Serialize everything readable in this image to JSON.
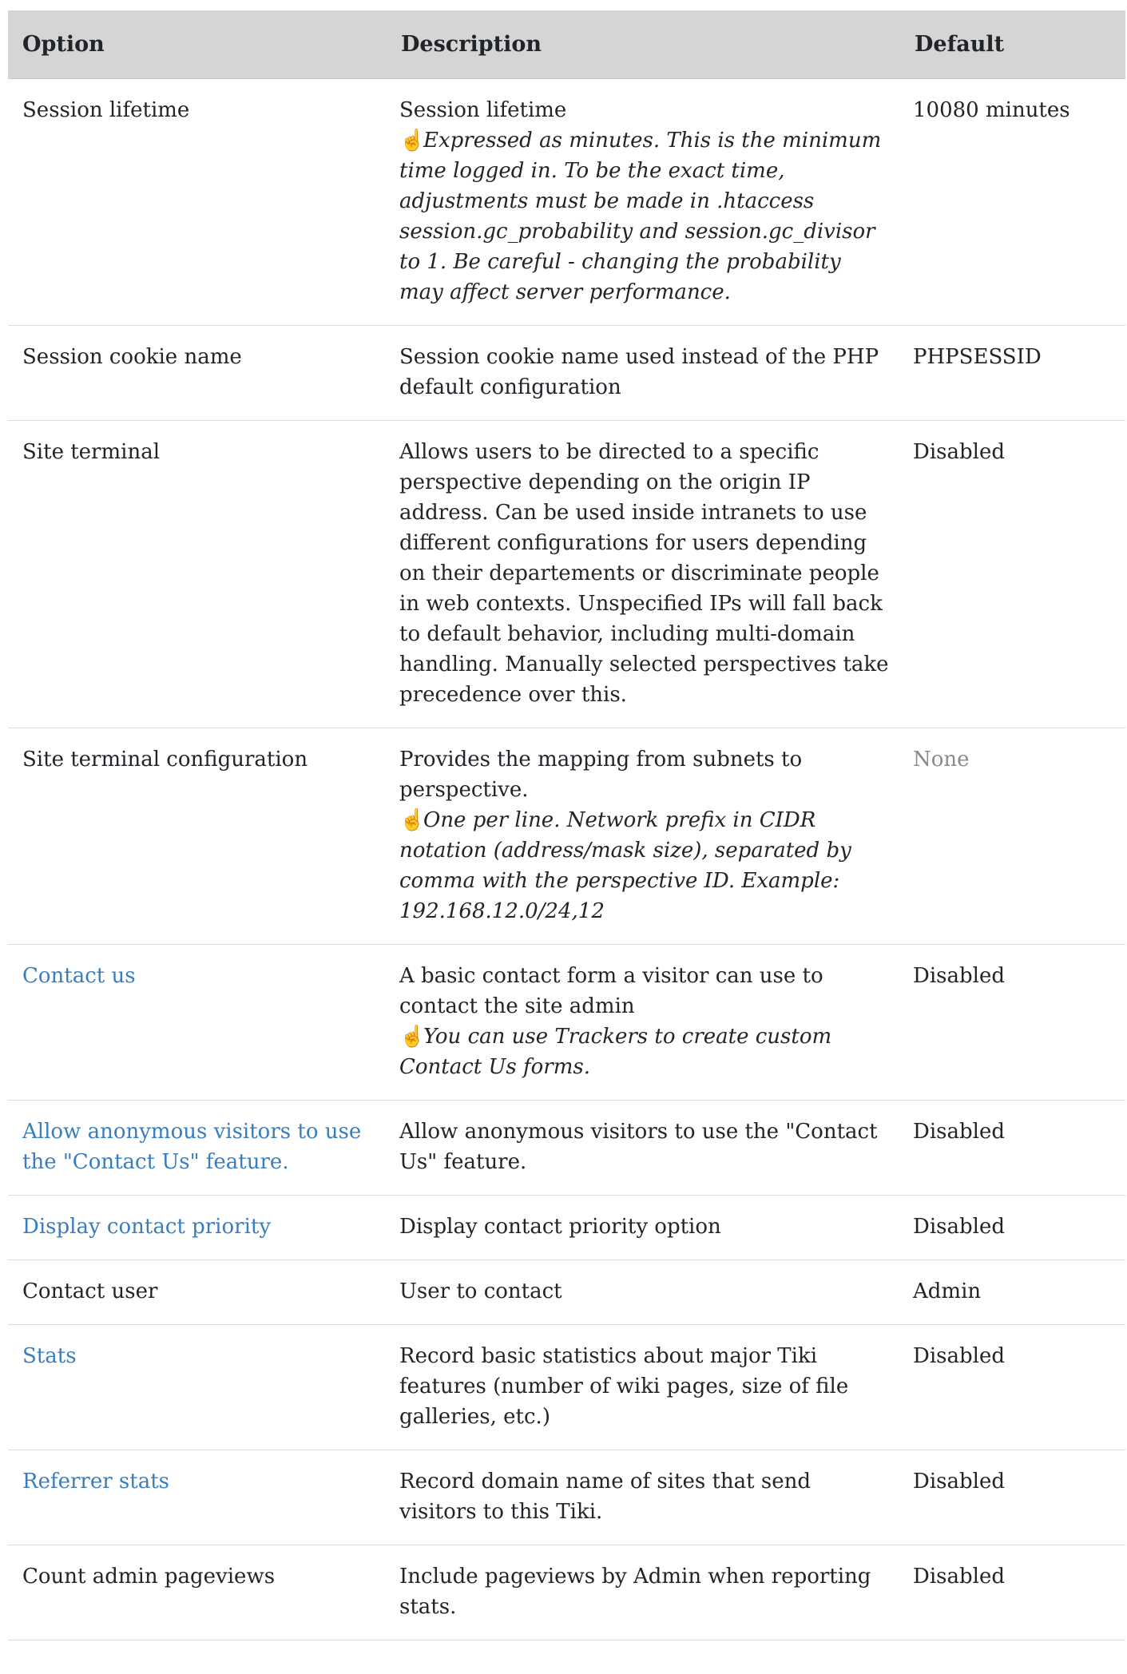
{
  "table": {
    "headers": {
      "option": "Option",
      "description": "Description",
      "default": "Default"
    },
    "rows": [
      {
        "option": "Session lifetime",
        "option_link": false,
        "description": "Session lifetime",
        "hint": "Expressed as minutes. This is the minimum time logged in. To be the exact time, adjustments must be made in .htaccess session.gc_probability and session.gc_divisor to 1. Be careful - changing the probability may affect server performance.",
        "default": "10080 minutes",
        "default_muted": false
      },
      {
        "option": "Session cookie name",
        "option_link": false,
        "description": "Session cookie name used instead of the PHP default configuration",
        "hint": "",
        "default": "PHPSESSID",
        "default_muted": false
      },
      {
        "option": "Site terminal",
        "option_link": false,
        "description": "Allows users to be directed to a specific perspective depending on the origin IP address. Can be used inside intranets to use different configurations for users depending on their departements or discriminate people in web contexts. Unspecified IPs will fall back to default behavior, including multi-domain handling. Manually selected perspectives take precedence over this.",
        "hint": "",
        "default": "Disabled",
        "default_muted": false
      },
      {
        "option": "Site terminal configuration",
        "option_link": false,
        "description": "Provides the mapping from subnets to perspective.",
        "hint": "One per line. Network prefix in CIDR notation (address/mask size), separated by comma with the perspective ID. Example: 192.168.12.0/24,12",
        "default": "None",
        "default_muted": true
      },
      {
        "option": "Contact us",
        "option_link": true,
        "description": "A basic contact form a visitor can use to contact the site admin",
        "hint": "You can use Trackers to create custom Contact Us forms.",
        "default": "Disabled",
        "default_muted": false
      },
      {
        "option": "Allow anonymous visitors to use the \"Contact Us\" feature.",
        "option_link": true,
        "description": "Allow anonymous visitors to use the \"Contact Us\" feature.",
        "hint": "",
        "default": "Disabled",
        "default_muted": false
      },
      {
        "option": "Display contact priority",
        "option_link": true,
        "description": "Display contact priority option",
        "hint": "",
        "default": "Disabled",
        "default_muted": false
      },
      {
        "option": "Contact user",
        "option_link": false,
        "description": "User to contact",
        "hint": "",
        "default": "Admin",
        "default_muted": false
      },
      {
        "option": "Stats",
        "option_link": true,
        "description": "Record basic statistics about major Tiki features (number of wiki pages, size of file galleries, etc.)",
        "hint": "",
        "default": "Disabled",
        "default_muted": false
      },
      {
        "option": "Referrer stats",
        "option_link": true,
        "description": "Record domain name of sites that send visitors to this Tiki.",
        "hint": "",
        "default": "Disabled",
        "default_muted": false
      },
      {
        "option": "Count admin pageviews",
        "option_link": false,
        "description": "Include pageviews by Admin when reporting stats.",
        "hint": "",
        "default": "Disabled",
        "default_muted": false
      }
    ]
  },
  "icons": {
    "hint_icon": "pointing-hand-icon"
  },
  "colors": {
    "header_bg": "#d5d5d5",
    "link": "#3a7dbf",
    "muted": "#8a8a8a",
    "text": "#212529"
  }
}
